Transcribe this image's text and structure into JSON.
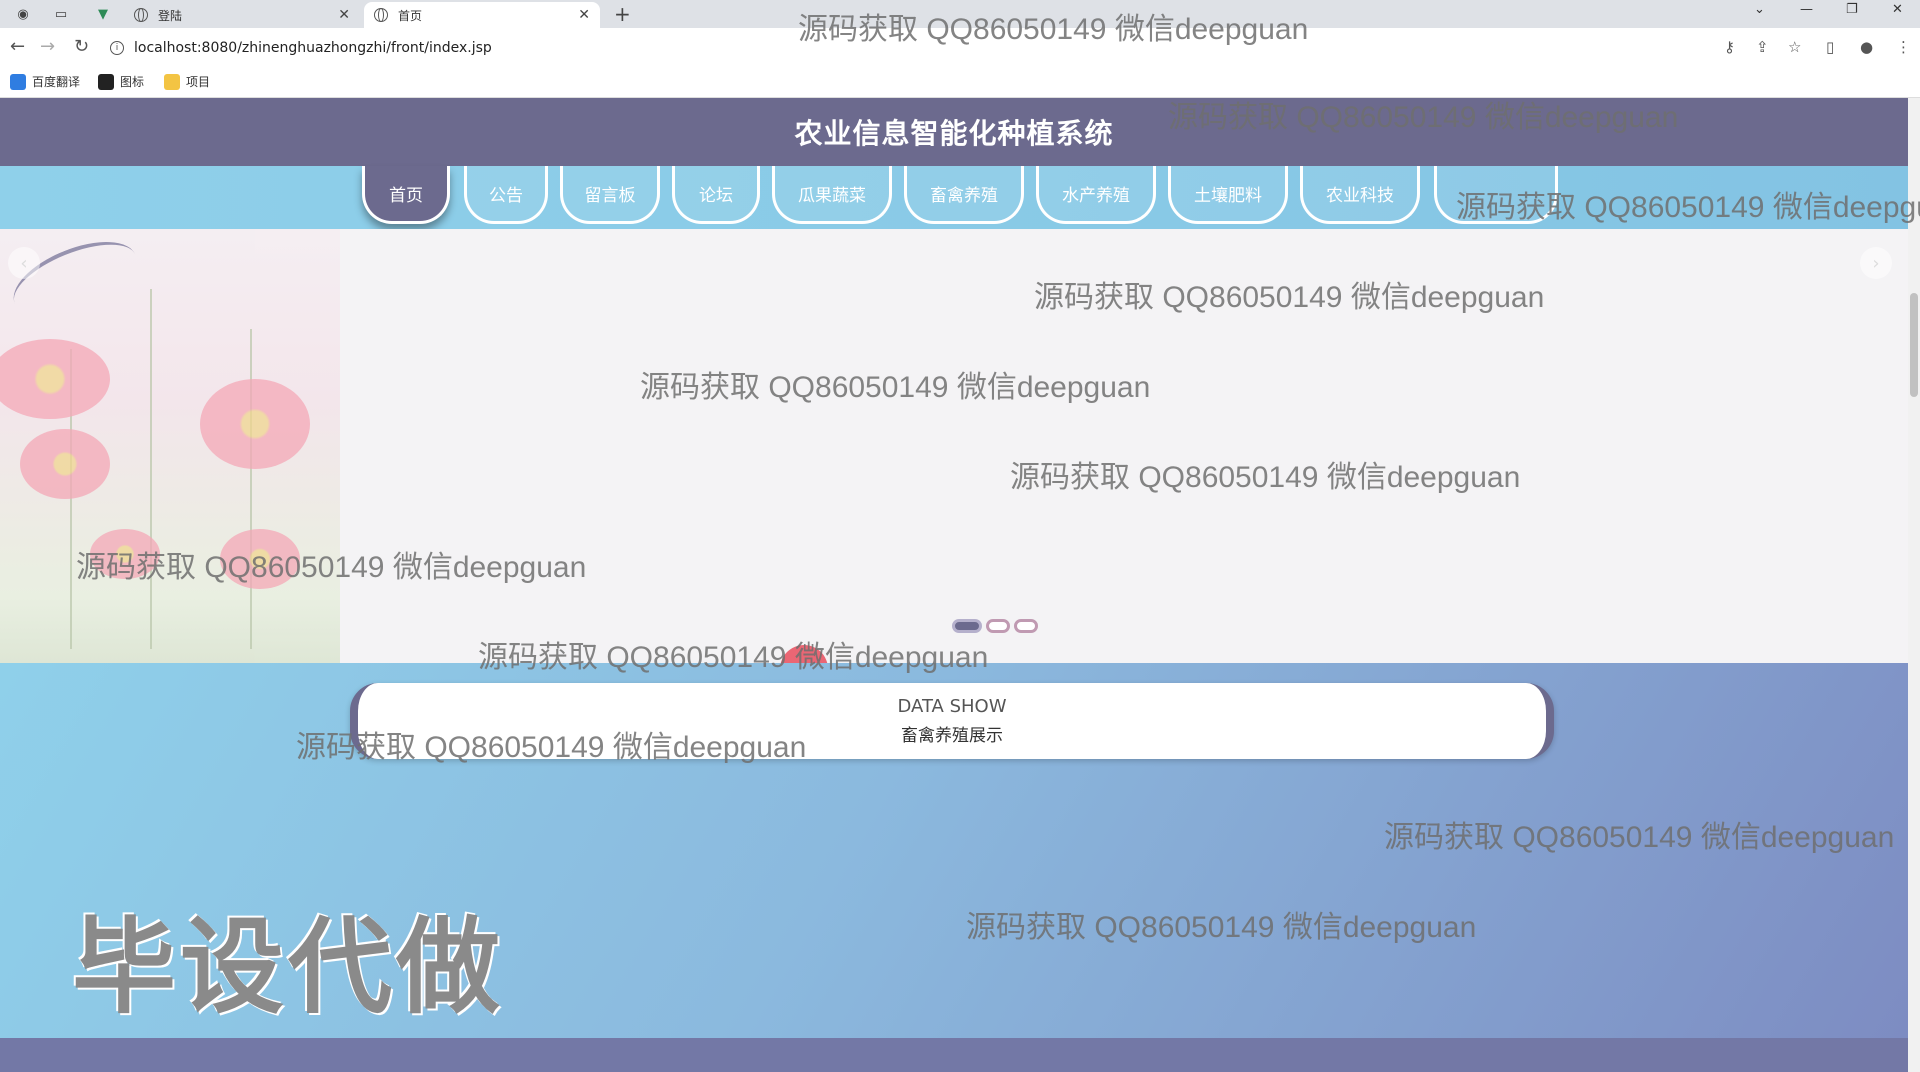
{
  "browser": {
    "tabs": [
      {
        "title": "登陆",
        "active": false
      },
      {
        "title": "首页",
        "active": true
      }
    ],
    "url": "localhost:8080/zhinenghuazhongzhi/front/index.jsp",
    "bookmarks": [
      "百度翻译",
      "图标",
      "项目"
    ]
  },
  "site": {
    "title": "农业信息智能化种植系统"
  },
  "nav": {
    "items": [
      "首页",
      "公告",
      "留言板",
      "论坛",
      "瓜果蔬菜",
      "畜禽养殖",
      "水产养殖",
      "土壤肥料",
      "农业科技"
    ]
  },
  "section": {
    "en": "DATA SHOW",
    "cn": "畜禽养殖展示"
  },
  "watermark": {
    "text": "源码获取 QQ86050149 微信deepguan",
    "big": "毕设代做"
  },
  "colors": {
    "header": "#6c6a8e",
    "nav": "#8fd0ea",
    "cursor": "#e95666"
  }
}
